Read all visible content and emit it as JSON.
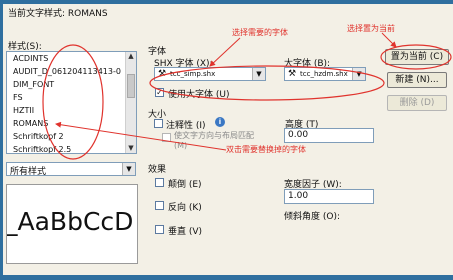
{
  "dialog": {
    "current_style_label": "当前文字样式: ROMANS",
    "styles_label": "样式(S):",
    "style_list": [
      "ACDINTS",
      "AUDIT_D_061204113413-0",
      "DIM_FONT",
      "FS",
      "HZTII",
      "ROMANS",
      "Schriftkopf 2",
      "Schriftkopf 2.5"
    ],
    "filter_value": "所有样式",
    "preview_text": "_AaBbCcD",
    "font_group": "字体",
    "shx_font_label": "SHX 字体 (X):",
    "shx_font_value": "tcc_simp.shx",
    "bigfont_label": "大字体 (B):",
    "bigfont_value": "tcc_hzdm.shx",
    "use_bigfont_label": "使用大字体 (U)",
    "use_bigfont_checked": true,
    "size_group": "大小",
    "annotative_label": "注释性 (I)",
    "info_icon": "info-icon",
    "match_orientation_label": "使文字方向与布局匹配 (M)",
    "height_label": "高度 (T)",
    "height_value": "0.00",
    "effects_group": "效果",
    "upside_down_label": "颠倒 (E)",
    "backwards_label": "反向 (K)",
    "vertical_label": "垂直 (V)",
    "width_factor_label": "宽度因子 (W):",
    "width_factor_value": "1.00",
    "oblique_label": "倾斜角度 (O):",
    "set_current_button": "置为当前 (C)",
    "new_button": "新建 (N)...",
    "delete_button": "删除 (D)"
  },
  "annotations": {
    "select_font_note": "选择需要的字体",
    "set_current_note": "选择置为当前",
    "double_click_note": "双击需要替换掉的字体",
    "annotation_color": "#e0332d"
  }
}
